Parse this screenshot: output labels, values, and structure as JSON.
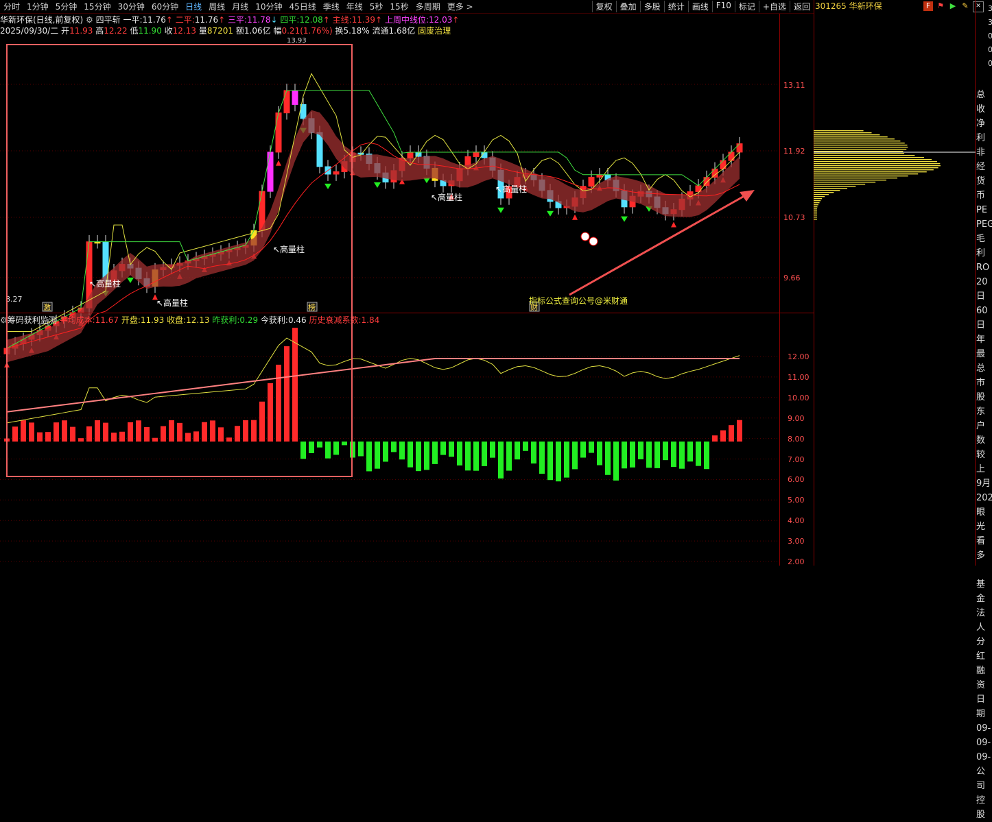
{
  "toolbar": {
    "tabs": [
      {
        "label": "分时",
        "active": false
      },
      {
        "label": "1分钟",
        "active": false
      },
      {
        "label": "5分钟",
        "active": false
      },
      {
        "label": "15分钟",
        "active": false
      },
      {
        "label": "30分钟",
        "active": false
      },
      {
        "label": "60分钟",
        "active": false
      },
      {
        "label": "日线",
        "active": true
      },
      {
        "label": "周线",
        "active": false
      },
      {
        "label": "月线",
        "active": false
      },
      {
        "label": "10分钟",
        "active": false
      },
      {
        "label": "45日线",
        "active": false
      },
      {
        "label": "季线",
        "active": false
      },
      {
        "label": "年线",
        "active": false
      },
      {
        "label": "5秒",
        "active": false
      },
      {
        "label": "15秒",
        "active": false
      },
      {
        "label": "多周期",
        "active": false
      },
      {
        "label": "更多 >",
        "active": false
      }
    ],
    "right_buttons": [
      "复权",
      "叠加",
      "多股",
      "统计",
      "画线",
      "F10",
      "标记",
      "+自选",
      "返回"
    ]
  },
  "stock": {
    "code_name": "301265 华新环保",
    "title": "华新环保(日线,前复权)",
    "indicator": "四平斩",
    "yiping_label": "一平:",
    "yiping": "11.76",
    "erping_label": "二平:",
    "erping": "11.76",
    "sanping_label": "三平:",
    "sanping": "11.78",
    "siping_label": "四平:",
    "siping": "12.08",
    "zhuxian_label": "主线:",
    "zhuxian": "11.39",
    "shangzhou_label": "上周中线位:",
    "shangzhou": "12.03"
  },
  "quote": {
    "date": "2025/09/30/二",
    "open_label": "开",
    "open": "11.93",
    "high_label": "高",
    "high": "12.22",
    "low_label": "低",
    "low": "11.90",
    "close_label": "收",
    "close": "12.13",
    "vol_label": "量",
    "vol": "87201",
    "amt_label": "额",
    "amt": "1.06亿",
    "chg_label": "幅",
    "chg": "0.21(1.76%)",
    "turnover_label": "换",
    "turnover": "5.18%",
    "float_label": "流通",
    "float": "1.68亿",
    "sector": "固废治理"
  },
  "sub": {
    "name": "筹码获利监测",
    "avg_label": "平均成本:",
    "avg": "11.67",
    "open_label": "开盘:",
    "open": "11.93",
    "close_label": "收盘:",
    "close": "12.13",
    "prev_label": "昨获利:",
    "prev": "0.29",
    "today_label": "今获利:",
    "today": "0.46",
    "decay_label": "历史衰减系数:",
    "decay": "1.84"
  },
  "main_axis": [
    "13.11",
    "11.92",
    "10.73",
    "9.66"
  ],
  "sub_axis": [
    "12.00",
    "11.00",
    "10.00",
    "9.00",
    "8.00",
    "7.00",
    "6.00",
    "5.00",
    "4.00",
    "3.00",
    "2.00"
  ],
  "annotations": {
    "gaoliangzhu": "高量柱",
    "low_price": "8.27",
    "high_price": "13.93",
    "marker_ji": "激",
    "marker_bang": "榜",
    "marker_cai": "财",
    "watermark": "指标公式查询公号@米财通"
  },
  "right_panel": {
    "labels": [
      "总收",
      "净利",
      "非经",
      "货币",
      "PE",
      "PEG",
      "毛利",
      "RO",
      "20日",
      "60日",
      "年最",
      "总市",
      "股东",
      "户数",
      "较上",
      "9月",
      "202",
      "眼光",
      "看多",
      "",
      "基金",
      "法人",
      "分红",
      "融资",
      "日期",
      "09-",
      "09-",
      "09-",
      "公司",
      "控股"
    ],
    "top": [
      "30",
      "3",
      "0",
      "0",
      "0"
    ]
  },
  "colors": {
    "up": "#ff2a2a",
    "down": "#22ee22",
    "cyan": "#55e0ff",
    "yellow": "#ffe020",
    "magenta": "#ff30ff",
    "axis": "#ff4040"
  }
}
